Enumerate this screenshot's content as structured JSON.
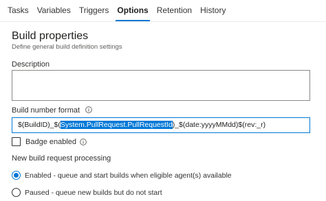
{
  "tabs": [
    {
      "label": "Tasks",
      "active": false
    },
    {
      "label": "Variables",
      "active": false
    },
    {
      "label": "Triggers",
      "active": false
    },
    {
      "label": "Options",
      "active": true
    },
    {
      "label": "Retention",
      "active": false
    },
    {
      "label": "History",
      "active": false
    }
  ],
  "section": {
    "title": "Build properties",
    "subtitle": "Define general build definition settings"
  },
  "description": {
    "label": "Description",
    "value": ""
  },
  "build_number_format": {
    "label": "Build number format",
    "info_icon": "info-icon",
    "value_before_selection": "$(BuildID)_$(",
    "value_selected": "System.PullRequest.PullRequestId",
    "value_after_selection": ")_$(date:yyyyMMdd)$(rev:_r)"
  },
  "badge": {
    "label": "Badge enabled",
    "checked": false,
    "info_icon": "info-icon"
  },
  "new_build_request": {
    "label": "New build request processing",
    "options": [
      {
        "label": "Enabled - queue and start builds when eligible agent(s) available",
        "selected": true
      },
      {
        "label": "Paused - queue new builds but do not start",
        "selected": false
      }
    ]
  },
  "colors": {
    "accent": "#0078d4",
    "selection": "#0078d7"
  }
}
